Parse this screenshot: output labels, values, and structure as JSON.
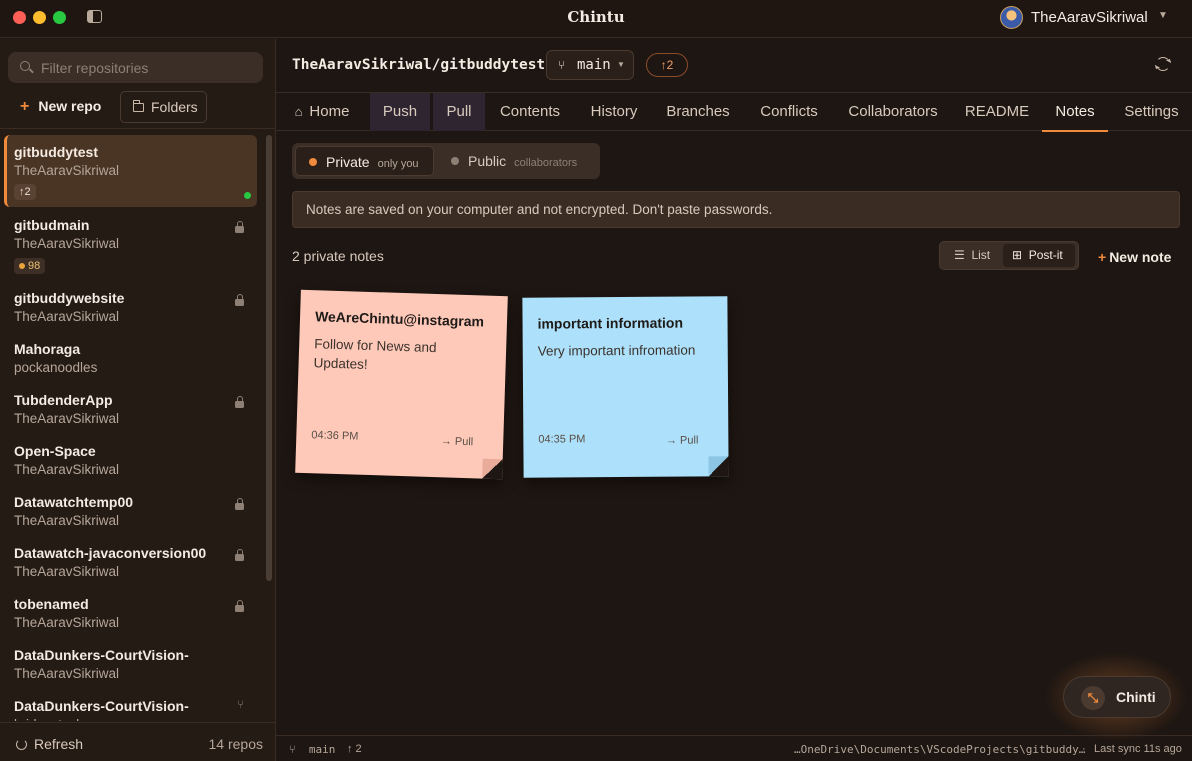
{
  "app": {
    "title": "Chintu"
  },
  "user": {
    "name": "TheAaravSikriwal"
  },
  "sidebar": {
    "filter_placeholder": "Filter repositories",
    "new_repo_label": "New repo",
    "folders_label": "Folders",
    "refresh_label": "Refresh",
    "repo_count": "14 repos",
    "repos": [
      {
        "name": "gitbuddytest",
        "owner": "TheAaravSikriwal",
        "badge": "↑2",
        "active": true,
        "status": "synced"
      },
      {
        "name": "gitbudmain",
        "owner": "TheAaravSikriwal",
        "badge": "98",
        "private": true
      },
      {
        "name": "gitbuddywebsite",
        "owner": "TheAaravSikriwal",
        "private": true
      },
      {
        "name": "Mahoraga",
        "owner": "pockanoodles"
      },
      {
        "name": "TubdenderApp",
        "owner": "TheAaravSikriwal",
        "private": true
      },
      {
        "name": "Open-Space",
        "owner": "TheAaravSikriwal"
      },
      {
        "name": "Datawatchtemp00",
        "owner": "TheAaravSikriwal",
        "private": true
      },
      {
        "name": "Datawatch-javaconversion00",
        "owner": "TheAaravSikriwal",
        "private": true
      },
      {
        "name": "tobenamed",
        "owner": "TheAaravSikriwal",
        "private": true
      },
      {
        "name": "DataDunkers-CourtVision-",
        "owner": "TheAaravSikriwal"
      },
      {
        "name": "DataDunkers-CourtVision-",
        "owner": "bridgestuck",
        "fork": true
      }
    ]
  },
  "repo": {
    "full_name": "TheAaravSikriwal/gitbuddytest",
    "branch": "main",
    "ahead": "↑2"
  },
  "tabs": [
    {
      "label": "Home",
      "icon": "home-icon"
    },
    {
      "label": "Push"
    },
    {
      "label": "Pull"
    },
    {
      "label": "Contents"
    },
    {
      "label": "History"
    },
    {
      "label": "Branches"
    },
    {
      "label": "Conflicts"
    },
    {
      "label": "Collaborators"
    },
    {
      "label": "README"
    },
    {
      "label": "Notes",
      "active": true
    },
    {
      "label": "Settings"
    }
  ],
  "notes_view": {
    "private_label": "Private",
    "private_sub": "only you",
    "public_label": "Public",
    "public_sub": "collaborators",
    "warning": "Notes are saved on your computer and not encrypted. Don't paste passwords.",
    "count_label": "2 private notes",
    "list_label": "List",
    "postit_label": "Post-it",
    "new_note_label": "New note",
    "accent_private": "#f08a3c",
    "accent_public": "#8e8074"
  },
  "notes": [
    {
      "title": "WeAreChintu@instagram",
      "body": "Follow for News and Updates!",
      "time": "04:36 PM",
      "action": "→ Pull",
      "color": "#ffc9b9"
    },
    {
      "title": "important information",
      "body": "Very important infromation",
      "time": "04:35 PM",
      "action": "→ Pull",
      "color": "#ade1fb"
    }
  ],
  "assistant": {
    "label": "Chinti"
  },
  "statusbar": {
    "branch": "main",
    "ahead": "↑ 2",
    "path": "…OneDrive\\Documents\\VScodeProjects\\gitbuddy…",
    "separator": "·",
    "last_sync": "Last sync 11s ago"
  }
}
